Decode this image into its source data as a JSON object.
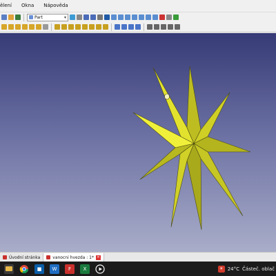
{
  "menu": {
    "items": [
      "ělení",
      "Okna",
      "Nápověda"
    ]
  },
  "toolbar": {
    "workbench": "Part"
  },
  "tabs": [
    {
      "label": "Úvodní stránka",
      "active": false
    },
    {
      "label": "vanocni hvezda : 1*",
      "active": true
    }
  ],
  "tray": {
    "weather_temp": "24°C",
    "weather_text": "Částeč. oblač"
  },
  "colors": {
    "star": "#c8c828",
    "star_light": "#e6e632",
    "star_dark": "#9a9a18",
    "bg_top": "#363a76",
    "bg_bottom": "#a9adc9"
  }
}
